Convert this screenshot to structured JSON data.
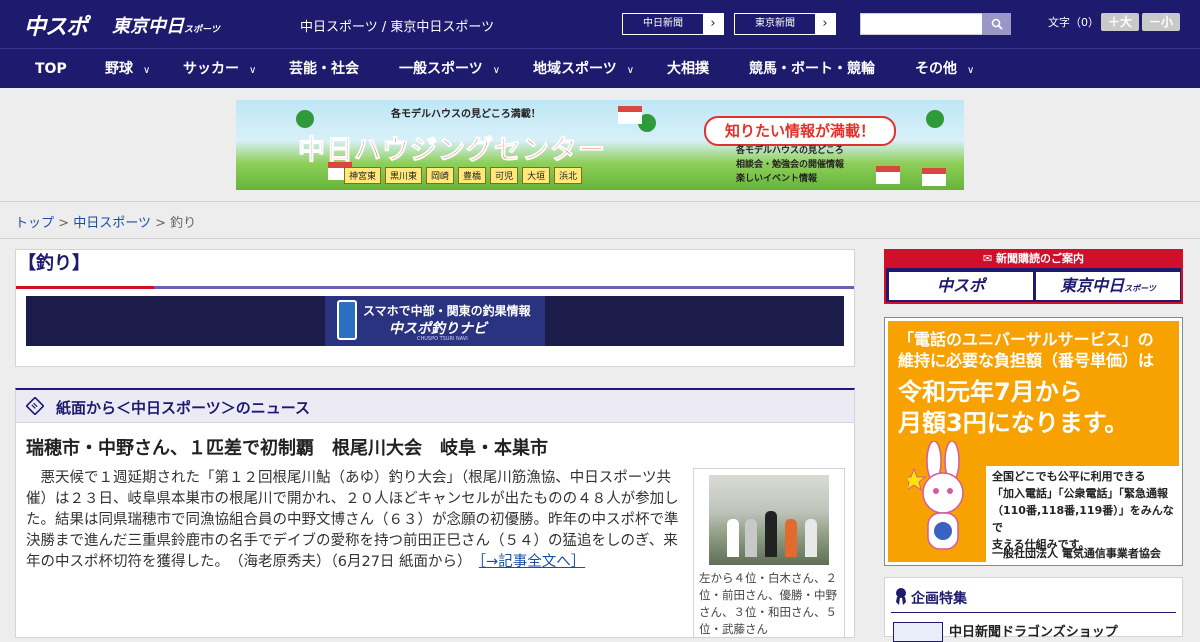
{
  "header": {
    "logo_chuspo": "中スポ",
    "logo_tokyo": "東京中日",
    "logo_tokyo_suffix": "スポーツ",
    "site_title": "中日スポーツ / 東京中日スポーツ",
    "paper_links": [
      {
        "label": "中日新聞"
      },
      {
        "label": "東京新聞"
      }
    ],
    "search": {
      "placeholder": "",
      "value": ""
    },
    "font_size": {
      "label": "文字（0）",
      "larger": "＋大",
      "smaller": "－小"
    }
  },
  "nav": {
    "items": [
      {
        "label": "TOP",
        "has_menu": false
      },
      {
        "label": "野球",
        "has_menu": true
      },
      {
        "label": "サッカー",
        "has_menu": true
      },
      {
        "label": "芸能・社会",
        "has_menu": false
      },
      {
        "label": "一般スポーツ",
        "has_menu": true
      },
      {
        "label": "地域スポーツ",
        "has_menu": true
      },
      {
        "label": "大相撲",
        "has_menu": false
      },
      {
        "label": "競馬・ボート・競輪",
        "has_menu": false
      },
      {
        "label": "その他",
        "has_menu": true
      }
    ]
  },
  "banner": {
    "top_copy": "各モデルハウスの見どころ満載！",
    "main_copy": "中日ハウジングセンター",
    "bubble": "知りたい情報が満載！",
    "features": [
      "各モデルハウスの見どころ",
      "相談会・勉強会の開催情報",
      "楽しいイベント情報"
    ],
    "cities": [
      "神宮東",
      "黒川東",
      "岡崎",
      "豊橋",
      "可児",
      "大垣",
      "浜北"
    ]
  },
  "breadcrumb": {
    "items": [
      "トップ",
      "中日スポーツ"
    ],
    "current": "釣り",
    "separator": ">"
  },
  "category": {
    "title": "【釣り】",
    "navi_banner": {
      "line1": "スマホで中部・関東の釣果情報",
      "line2": "中スポ釣りナビ",
      "line3": "CHUSPO TSURI NAVI"
    }
  },
  "news": {
    "section_title": "紙面から＜中日スポーツ＞のニュース",
    "headline": "瑞穂市・中野さん、１匹差で初制覇　根尾川大会　岐阜・本巣市",
    "body": "悪天候で１週延期された「第１２回根尾川鮎（あゆ）釣り大会」（根尾川筋漁協、中日スポーツ共催）は２３日、岐阜県本巣市の根尾川で開かれ、２０人ほどキャンセルが出たものの４８人が参加した。結果は同県瑞穂市で同漁協組合員の中野文博さん（６３）が念願の初優勝。昨年の中スポ杯で準決勝まで進んだ三重県鈴鹿市の名手でデイブの愛称を持つ前田正巳さん（５４）の猛追をしのぎ、来年の中スポ杯切符を獲得した。　（海老原秀夫）（6月27日 紙面から）",
    "more_link": "［→記事全文へ］",
    "photo_caption": "左から４位・白木さん、２位・前田さん、優勝・中野さん、３位・和田さん、５位・武藤さん"
  },
  "sidebar": {
    "subscribe": {
      "heading": "新聞購読のご案内",
      "buttons": [
        "中スポ",
        "東京中日"
      ],
      "button_suffix": "スポーツ"
    },
    "universal_ad": {
      "line1": "「電話のユニバーサルサービス」の",
      "line2": "維持に必要な負担額（番号単価）は",
      "line3": "令和元年7月から",
      "line4": "月額3円になります。",
      "detail1": "全国どこでも公平に利用できる",
      "detail2": "「加入電話」「公衆電話」「緊急通報",
      "detail3": "（110番,118番,119番）」をみんなで",
      "detail4": "支える仕組みです。",
      "org": "一般社団法人 電気通信事業者協会"
    },
    "features": {
      "title": "企画特集",
      "first_item": "中日新聞ドラゴンズショップ"
    }
  },
  "colors": {
    "brand_navy": "#1e1a6e",
    "accent_red": "#d0102a",
    "link_blue": "#1a4fa3",
    "ad_orange": "#f7a200"
  }
}
